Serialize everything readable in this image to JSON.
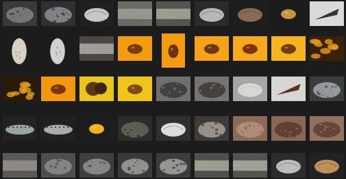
{
  "gallery": {
    "background": "#1c1c1c",
    "rows": [
      {
        "items": [
          {
            "subject": "gray-rock-with-holes",
            "colors": [
              "#3a3a3a",
              "#7d7d7d"
            ]
          },
          {
            "subject": "textured-rock",
            "colors": [
              "#2f3032",
              "#8a8c8f"
            ]
          },
          {
            "subject": "white-shell",
            "colors": [
              "#202020",
              "#c7c7c5"
            ]
          },
          {
            "subject": "gray-stone-layers",
            "colors": [
              "#6a6b66",
              "#9b9a92"
            ]
          },
          {
            "subject": "gray-stone-bar",
            "colors": [
              "#545550",
              "#a2a296"
            ]
          },
          {
            "subject": "pale-shell",
            "colors": [
              "#2a2a2a",
              "#b7b7b3"
            ]
          },
          {
            "subject": "brown-shell",
            "colors": [
              "#1e1e1e",
              "#8a6b55"
            ]
          },
          {
            "subject": "amber-stones",
            "colors": [
              "#1b1b1b",
              "#c8963a"
            ]
          },
          {
            "subject": "cone-shell",
            "colors": [
              "#d9d9d9",
              "#3a3431"
            ]
          }
        ]
      },
      {
        "items": [
          {
            "subject": "cream-pebble",
            "colors": [
              "#1c1c1c",
              "#d7d1c3"
            ]
          },
          {
            "subject": "white-pebble",
            "colors": [
              "#1c1c1c",
              "#cfd1d2"
            ]
          },
          {
            "subject": "mineral-slab",
            "colors": [
              "#4a4745",
              "#a8a49f"
            ]
          },
          {
            "subject": "amber-on-orange",
            "colors": [
              "#f39c12",
              "#7a3b08"
            ]
          },
          {
            "subject": "amber-on-orange-tall",
            "colors": [
              "#f39c12",
              "#6e3208"
            ]
          },
          {
            "subject": "amber-on-orange",
            "colors": [
              "#f6a21a",
              "#6c3a0b"
            ]
          },
          {
            "subject": "amber-on-orange",
            "colors": [
              "#f7a91d",
              "#7a3406"
            ]
          },
          {
            "subject": "amber-on-yellow",
            "colors": [
              "#f7b51d",
              "#743c0c"
            ]
          },
          {
            "subject": "amber-cluster",
            "colors": [
              "#3a2207",
              "#e59a1f"
            ]
          }
        ]
      },
      {
        "items": [
          {
            "subject": "amber-cluster-dark",
            "colors": [
              "#2b1a05",
              "#e0a020"
            ]
          },
          {
            "subject": "amber-on-orange",
            "colors": [
              "#f2970e",
              "#7a3607"
            ]
          },
          {
            "subject": "amber-pair-on-yellow",
            "colors": [
              "#e8c61e",
              "#5a3a13"
            ]
          },
          {
            "subject": "amber-on-yellow",
            "colors": [
              "#f0c419",
              "#834a10"
            ]
          },
          {
            "subject": "porous-stone",
            "colors": [
              "#6f6f6f",
              "#3c3c3c"
            ]
          },
          {
            "subject": "gray-rock-holes",
            "colors": [
              "#77736f",
              "#3f3c3a"
            ]
          },
          {
            "subject": "silver-shell",
            "colors": [
              "#a8a6a4",
              "#d8d7d4"
            ]
          },
          {
            "subject": "cone-shell-pattern",
            "colors": [
              "#d9d6d2",
              "#5a3320"
            ]
          },
          {
            "subject": "dark-rock",
            "colors": [
              "#3a3c3f",
              "#9ea2a5"
            ]
          }
        ]
      },
      {
        "items": [
          {
            "subject": "abalone-shell",
            "colors": [
              "#222222",
              "#9aa3a6"
            ]
          },
          {
            "subject": "abalone-shell",
            "colors": [
              "#202020",
              "#a7adae"
            ]
          },
          {
            "subject": "amber-on-yellow",
            "colors": [
              "#1d1d1d",
              "#f2b11a"
            ]
          },
          {
            "subject": "dark-green-rock",
            "colors": [
              "#2c2d28",
              "#5e6555"
            ]
          },
          {
            "subject": "white-ridged-shell",
            "colors": [
              "#303030",
              "#dcdcdc"
            ]
          },
          {
            "subject": "gray-rock",
            "colors": [
              "#3e3b38",
              "#a19b93"
            ]
          },
          {
            "subject": "brown-rock-texture",
            "colors": [
              "#8b6a58",
              "#b48f7d"
            ]
          },
          {
            "subject": "brown-porous-rock",
            "colors": [
              "#8b6656",
              "#5b3b2e"
            ]
          },
          {
            "subject": "brown-pitted-rock",
            "colors": [
              "#93715f",
              "#5e4134"
            ]
          }
        ]
      },
      {
        "items": [
          {
            "subject": "gray-stone-layers",
            "colors": [
              "#5a5955",
              "#8f8d86"
            ]
          },
          {
            "subject": "gray-rock-with-holes",
            "colors": [
              "#4e4e4e",
              "#8a8a8a"
            ]
          },
          {
            "subject": "textured-stone",
            "colors": [
              "#3e3f40",
              "#8d8e8f"
            ]
          },
          {
            "subject": "gray-stone-cluster",
            "colors": [
              "#3a3a3a",
              "#9a9a96"
            ]
          },
          {
            "subject": "gray-stone-cluster",
            "colors": [
              "#3c3c3c",
              "#a09f9a"
            ]
          },
          {
            "subject": "gray-stone-bar",
            "colors": [
              "#4f504b",
              "#a3a398"
            ]
          },
          {
            "subject": "gray-stone-bar",
            "colors": [
              "#53544e",
              "#a6a69a"
            ]
          },
          {
            "subject": "pale-shell",
            "colors": [
              "#2c2c2c",
              "#bcbcb8"
            ]
          },
          {
            "subject": "brown-spotted-shell",
            "colors": [
              "#222222",
              "#bf8f57"
            ]
          }
        ]
      }
    ]
  }
}
